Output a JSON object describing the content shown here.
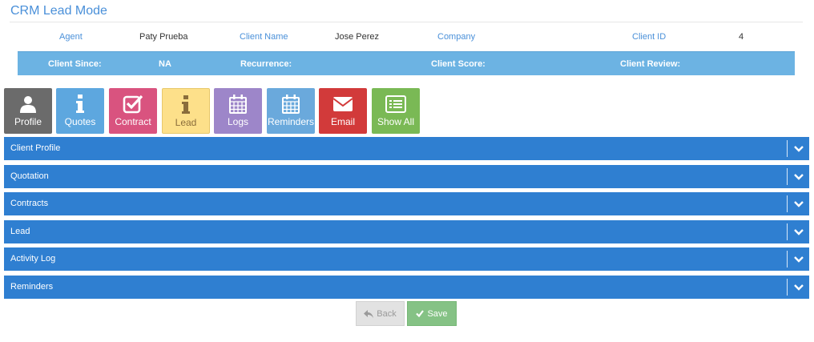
{
  "page": {
    "title": "CRM Lead Mode"
  },
  "info": {
    "agent_label": "Agent",
    "agent_value": "Paty Prueba",
    "client_name_label": "Client Name",
    "client_name_value": "Jose Perez",
    "company_label": "Company",
    "company_value": "",
    "client_id_label": "Client ID",
    "client_id_value": "4"
  },
  "band": {
    "client_since_label": "Client Since:",
    "client_since_value": "NA",
    "recurrence_label": "Recurrence:",
    "recurrence_value": "",
    "client_score_label": "Client Score:",
    "client_score_value": "",
    "client_review_label": "Client Review:",
    "client_review_value": ""
  },
  "toolbar": {
    "buttons": [
      {
        "label": "Profile",
        "icon": "user-icon",
        "color": "#6b6b6b"
      },
      {
        "label": "Quotes",
        "icon": "info-icon",
        "color": "#5da7df"
      },
      {
        "label": "Contract",
        "icon": "checkbox-icon",
        "color": "#d9537f"
      },
      {
        "label": "Lead",
        "icon": "info-icon",
        "color": "#fde08a"
      },
      {
        "label": "Logs",
        "icon": "calendar-icon",
        "color": "#9d86c9"
      },
      {
        "label": "Reminders",
        "icon": "calendar-icon",
        "color": "#6aa9dc"
      },
      {
        "label": "Email",
        "icon": "envelope-icon",
        "color": "#d23a3a"
      },
      {
        "label": "Show All",
        "icon": "list-icon",
        "color": "#7ab955"
      }
    ]
  },
  "panels": [
    {
      "title": "Client Profile"
    },
    {
      "title": "Quotation"
    },
    {
      "title": "Contracts"
    },
    {
      "title": "Lead"
    },
    {
      "title": "Activity Log"
    },
    {
      "title": "Reminders"
    }
  ],
  "actions": {
    "back_label": "Back",
    "save_label": "Save"
  },
  "colors": {
    "accent": "#4a90d9",
    "panel": "#2f7fd1",
    "band": "#6cb3e3"
  }
}
